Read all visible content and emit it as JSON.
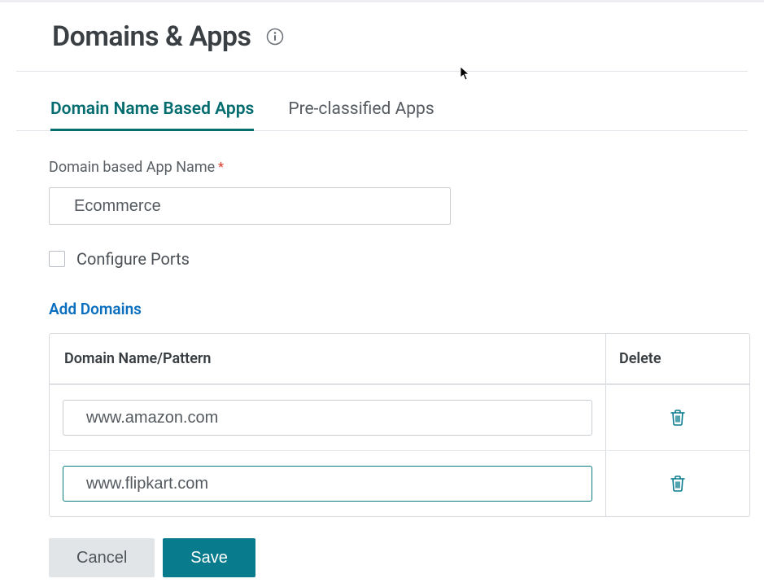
{
  "header": {
    "title": "Domains & Apps",
    "info_icon": "info-icon"
  },
  "tabs": [
    {
      "label": "Domain Name Based Apps",
      "active": true
    },
    {
      "label": "Pre-classified Apps",
      "active": false
    }
  ],
  "form": {
    "app_name_label": "Domain based App Name",
    "app_name_required": true,
    "app_name_value": "Ecommerce",
    "configure_ports_label": "Configure Ports",
    "configure_ports_checked": false,
    "add_domains_label": "Add Domains"
  },
  "domains_table": {
    "col_name": "Domain Name/Pattern",
    "col_delete": "Delete",
    "rows": [
      {
        "value": "www.amazon.com",
        "focused": false
      },
      {
        "value": "www.flipkart.com",
        "focused": true
      }
    ]
  },
  "actions": {
    "cancel": "Cancel",
    "save": "Save"
  },
  "colors": {
    "accent": "#087b8d",
    "link": "#0b6fbf",
    "danger": "#d93b2b"
  }
}
